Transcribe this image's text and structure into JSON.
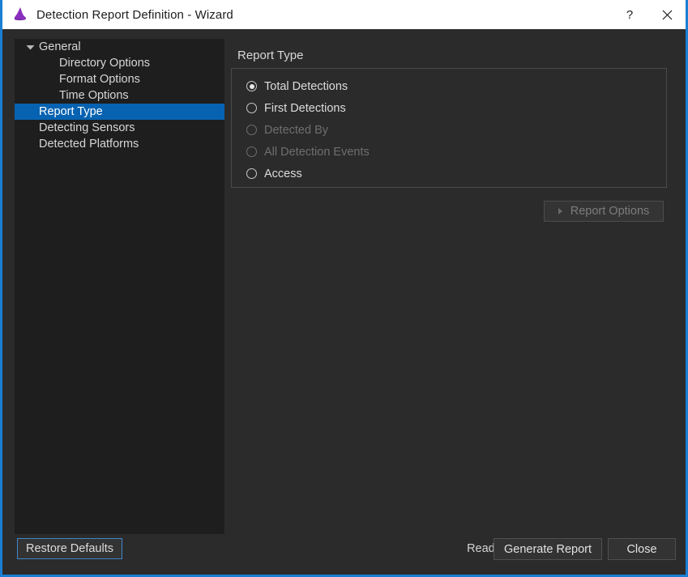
{
  "window": {
    "title": "Detection Report Definition - Wizard",
    "icon": "wizard-hat-icon",
    "accent_border_color": "#1a7fd4",
    "titlebar_bg": "#ffffff",
    "body_bg": "#2b2b2b",
    "sidebar_bg": "#1e1e1e",
    "selection_color": "#0763b1",
    "controls": {
      "help_label": "?",
      "close_label": "✕"
    }
  },
  "sidebar": {
    "items": [
      {
        "label": "General",
        "level": 0,
        "selected": false,
        "expander": "chevron-down-icon"
      },
      {
        "label": "Directory Options",
        "level": 1,
        "selected": false,
        "expander": null
      },
      {
        "label": "Format Options",
        "level": 1,
        "selected": false,
        "expander": null
      },
      {
        "label": "Time Options",
        "level": 1,
        "selected": false,
        "expander": null
      },
      {
        "label": "Report Type",
        "level": 0,
        "selected": true,
        "expander": null
      },
      {
        "label": "Detecting Sensors",
        "level": 0,
        "selected": false,
        "expander": null
      },
      {
        "label": "Detected Platforms",
        "level": 0,
        "selected": false,
        "expander": null
      }
    ]
  },
  "main": {
    "panel_title": "Report Type",
    "radio_group": {
      "options": [
        {
          "label": "Total Detections",
          "checked": true,
          "disabled": false
        },
        {
          "label": "First Detections",
          "checked": false,
          "disabled": false
        },
        {
          "label": "Detected By",
          "checked": false,
          "disabled": true
        },
        {
          "label": "All Detection Events",
          "checked": false,
          "disabled": true
        },
        {
          "label": "Access",
          "checked": false,
          "disabled": false
        }
      ]
    },
    "report_options_button": {
      "label": "Report Options",
      "icon": "triangle-right-icon",
      "disabled": true
    }
  },
  "footer": {
    "restore_defaults_label": "Restore Defaults",
    "status_text": "Ready",
    "generate_report_label": "Generate Report",
    "close_label": "Close"
  }
}
